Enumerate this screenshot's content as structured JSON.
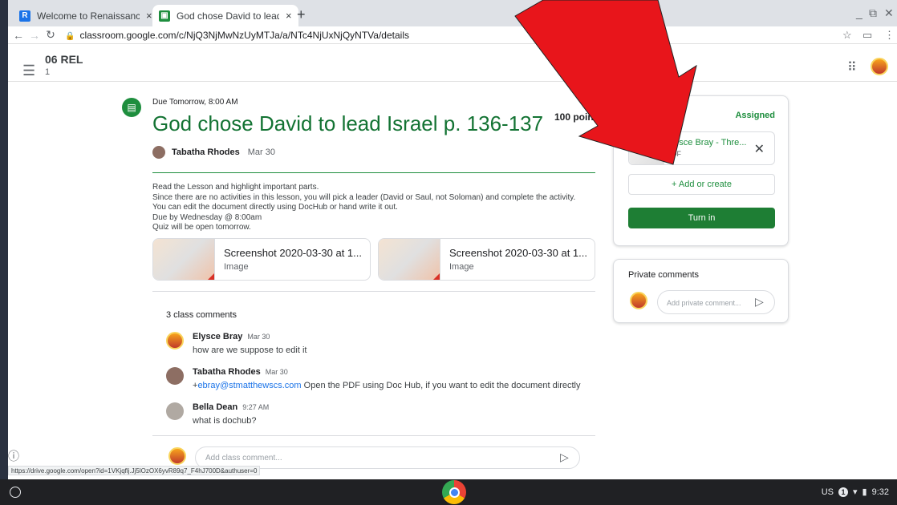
{
  "browser": {
    "tabs": [
      {
        "title": "Welcome to Renaissance Place",
        "icon": "R",
        "color": "#1a73e8"
      },
      {
        "title": "God chose David to lead Israel p",
        "icon": "classroom",
        "color": "#1e8e3e"
      }
    ],
    "url": "classroom.google.com/c/NjQ3NjMwNzUyMTJa/a/NTc4NjUxNjQyNTVa/details",
    "status_url": "https://drive.google.com/open?id=1VKjqflj.Jj5lOzOX6yvR89q7_F4hJ700D&authuser=0"
  },
  "classroom": {
    "class_name": "06 REL",
    "section": "1"
  },
  "assignment": {
    "due": "Due Tomorrow, 8:00 AM",
    "title": "God chose David to lead Israel p. 136-137",
    "points": "100 points",
    "author": "Tabatha Rhodes",
    "date": "Mar 30",
    "description": "Read the Lesson and highlight important parts.\nSince there are no activities in this lesson, you will pick a leader (David or Saul, not Soloman) and complete the activity.\nYou can edit the document directly using DocHub or hand write it out.\nDue by Wednesday @ 8:00am\nQuiz will be open tomorrow.",
    "attachments": [
      {
        "name": "Screenshot 2020-03-30 at 1...",
        "type": "Image"
      },
      {
        "name": "Screenshot 2020-03-30 at 1...",
        "type": "Image"
      }
    ]
  },
  "comments": {
    "count_label": "3 class comments",
    "items": [
      {
        "name": "Elysce Bray",
        "date": "Mar 30",
        "text": "how are we suppose to edit it"
      },
      {
        "name": "Tabatha Rhodes",
        "date": "Mar 30",
        "prefix": "+",
        "link": "ebray@stmatthewscs.com",
        "text": " Open the PDF using Doc Hub, if you want to edit the document directly"
      },
      {
        "name": "Bella Dean",
        "date": "9:27 AM",
        "text": "what is dochub?"
      }
    ],
    "placeholder": "Add class comment..."
  },
  "your_work": {
    "title": "ork",
    "status": "Assigned",
    "file_name": "Elysce Bray - Thre...",
    "file_type": "PDF",
    "add_label": "+ Add or create",
    "turn_in_label": "Turn in"
  },
  "private_comments": {
    "title": "Private comments",
    "placeholder": "Add private comment..."
  },
  "shelf": {
    "locale": "US",
    "notification_count": "1",
    "time": "9:32"
  },
  "annotation_color": "#e8151b"
}
